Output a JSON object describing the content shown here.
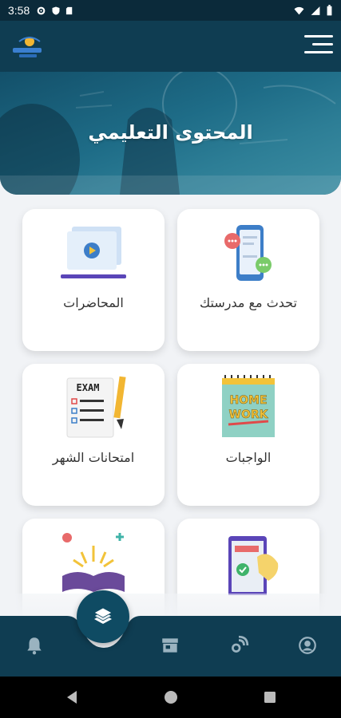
{
  "status_bar": {
    "time": "3:58"
  },
  "hero": {
    "title": "المحتوى التعليمي"
  },
  "cards": [
    {
      "label": "تحدث مع مدرستك",
      "icon": "chat-phone-icon"
    },
    {
      "label": "المحاضرات",
      "icon": "video-lectures-icon"
    },
    {
      "label": "الواجبات",
      "icon": "homework-notebook-icon"
    },
    {
      "label": "امتحانات الشهر",
      "icon": "exam-list-icon"
    },
    {
      "label": "",
      "icon": "mobile-check-icon"
    },
    {
      "label": "",
      "icon": "open-book-icon"
    }
  ],
  "bottom_nav": {
    "items": [
      "profile-icon",
      "podcast-icon",
      "store-icon",
      "notification-bell-icon"
    ],
    "fab_icon": "books-stack-icon"
  },
  "colors": {
    "primary": "#0f3d52",
    "background": "#f1f3f6",
    "card": "#ffffff"
  }
}
